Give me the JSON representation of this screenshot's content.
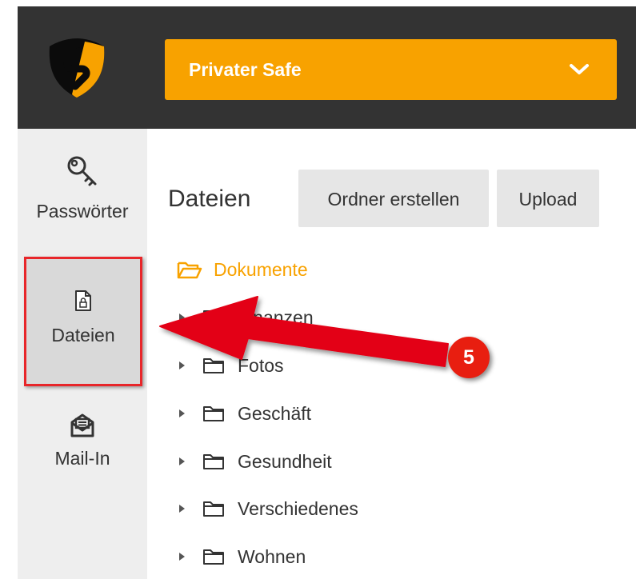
{
  "header": {
    "safe_selector": {
      "label": "Privater Safe"
    },
    "accent_color": "#f8a200",
    "background_color": "#333333"
  },
  "sidebar": {
    "items": [
      {
        "label": "Passwörter",
        "icon": "key-icon",
        "active": false
      },
      {
        "label": "Dateien",
        "icon": "locked-file-icon",
        "active": true
      },
      {
        "label": "Mail-In",
        "icon": "mail-icon",
        "active": false
      }
    ]
  },
  "main": {
    "title": "Dateien",
    "buttons": {
      "create_folder": "Ordner erstellen",
      "upload": "Upload"
    },
    "tree": {
      "root": {
        "label": "Dokumente",
        "icon": "folder-open-icon",
        "expanded": true
      },
      "children": [
        {
          "label": "Finanzen",
          "icon": "folder-icon"
        },
        {
          "label": "Fotos",
          "icon": "folder-icon"
        },
        {
          "label": "Geschäft",
          "icon": "folder-icon"
        },
        {
          "label": "Gesundheit",
          "icon": "folder-icon"
        },
        {
          "label": "Verschiedenes",
          "icon": "folder-icon"
        },
        {
          "label": "Wohnen",
          "icon": "folder-icon"
        }
      ]
    }
  },
  "annotation": {
    "step_number": "5",
    "highlight_color": "#e8262a"
  }
}
